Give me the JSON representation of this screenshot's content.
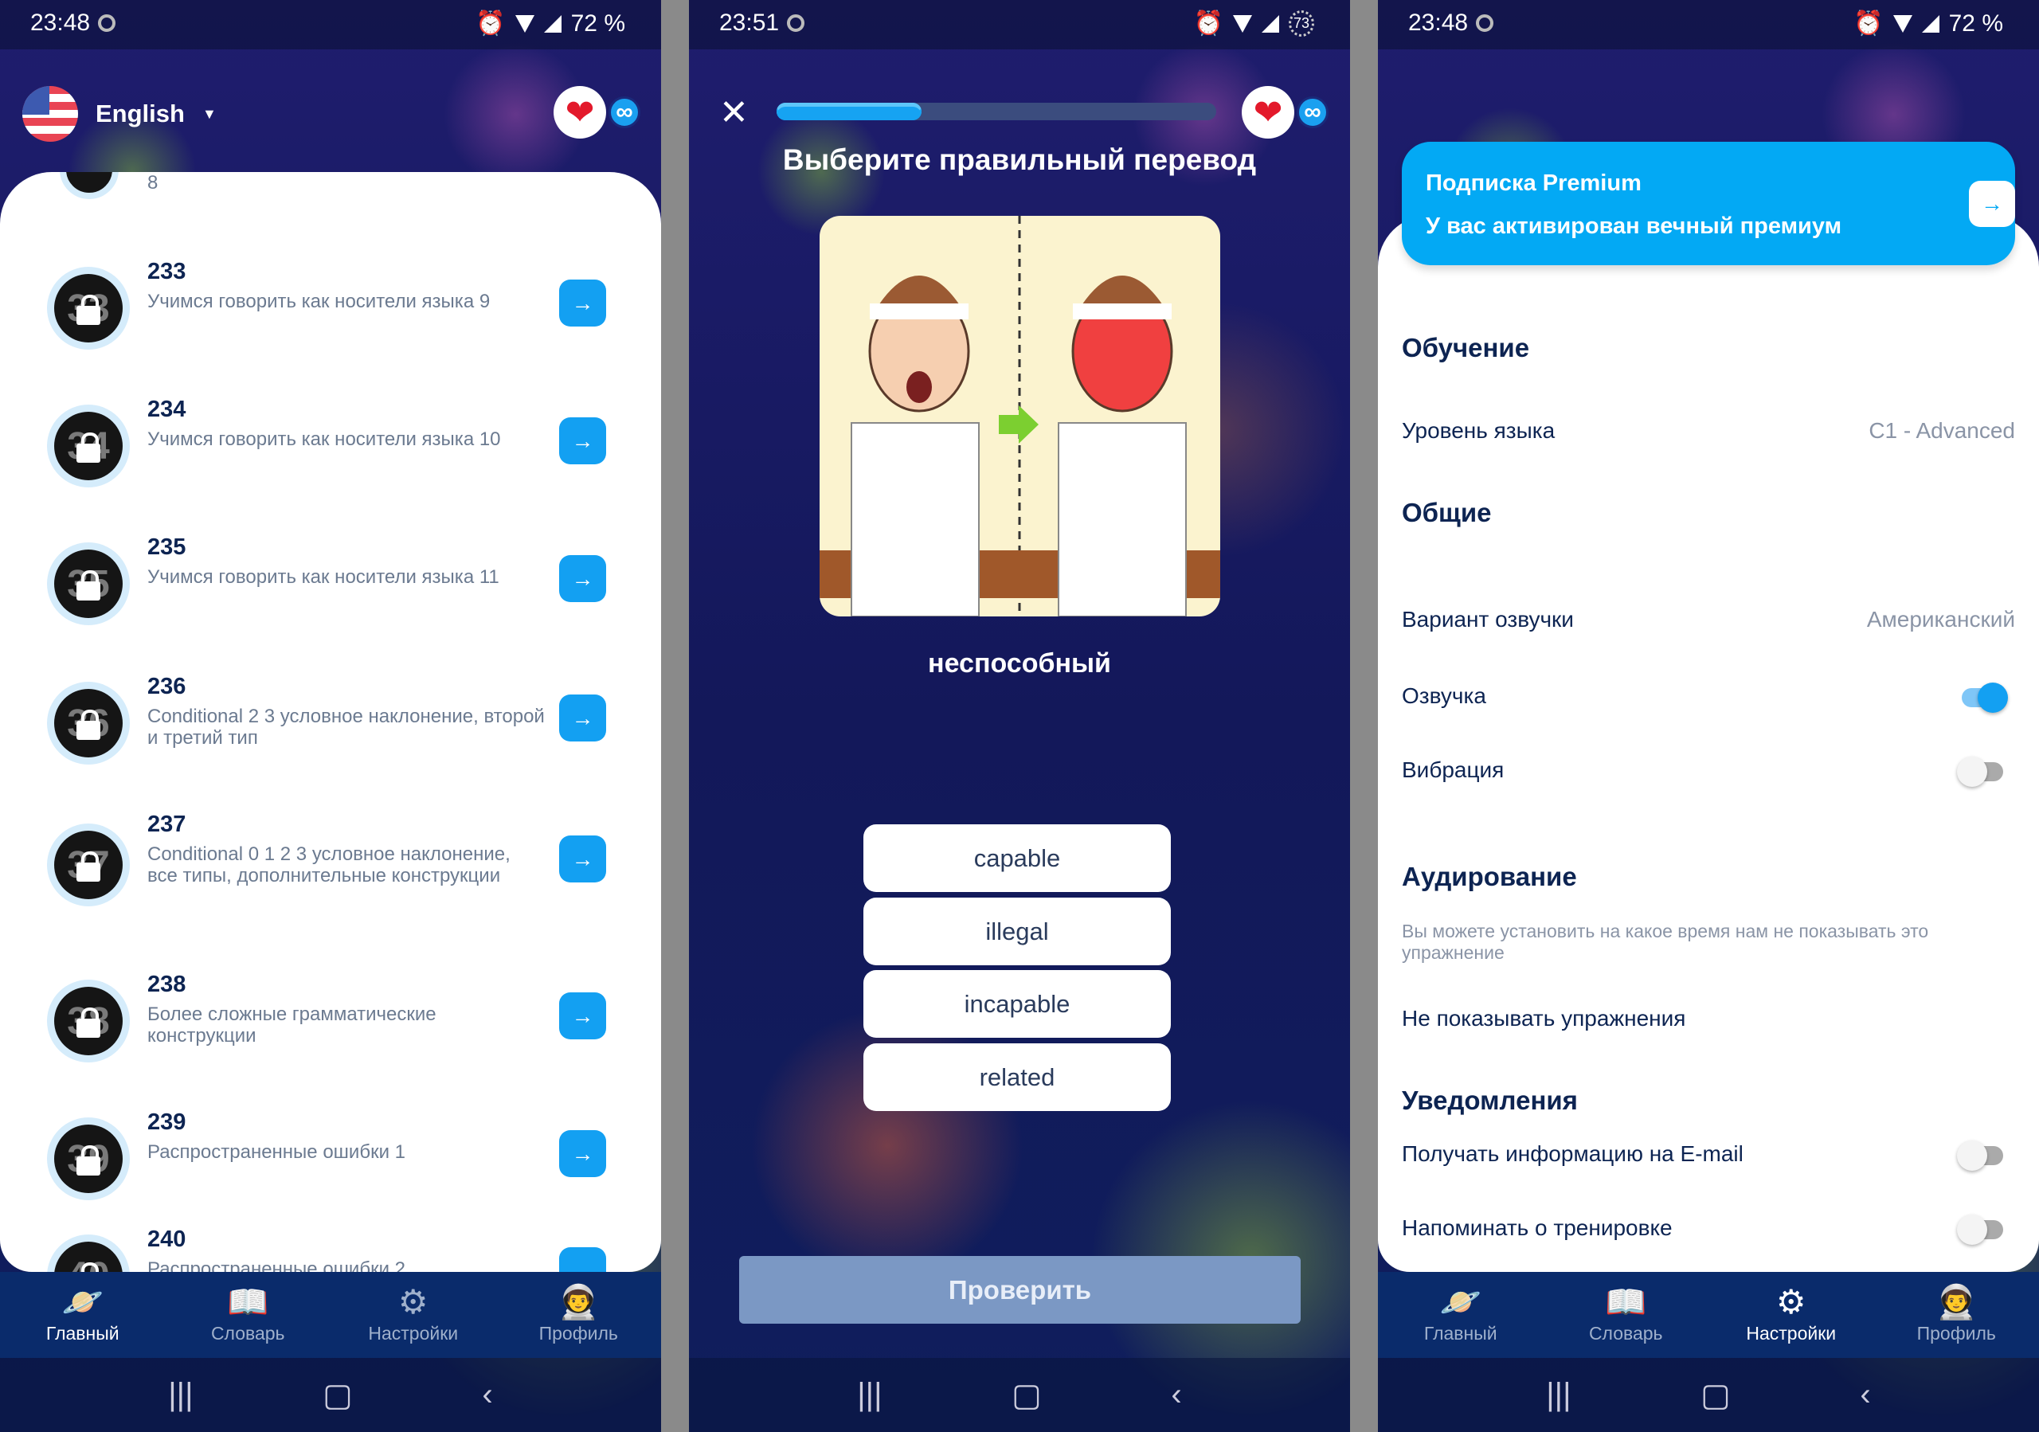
{
  "colors": {
    "accent": "#13a0f2",
    "nav_bg": "#0a2b6b",
    "heading": "#0d2452",
    "premium": "#03a9f4",
    "check_disabled": "#7b98c4"
  },
  "screens": [
    {
      "status": {
        "time": "23:48",
        "battery": "72 %"
      }
    },
    {
      "status": {
        "time": "23:51",
        "battery": "73"
      }
    },
    {
      "status": {
        "time": "23:48",
        "battery": "72 %"
      }
    }
  ],
  "home": {
    "language": "English",
    "lives_icon": "heart-icon",
    "lives": "∞",
    "partial_item_sub": "8",
    "lessons": [
      {
        "num": "233",
        "badge": "33",
        "title": "Учимся говорить как носители языка 9"
      },
      {
        "num": "234",
        "badge": "34",
        "title": "Учимся говорить как носители языка 10"
      },
      {
        "num": "235",
        "badge": "35",
        "title": "Учимся говорить как носители языка 11"
      },
      {
        "num": "236",
        "badge": "36",
        "title": "Conditional  2 3 условное наклонение, второй и третий тип"
      },
      {
        "num": "237",
        "badge": "37",
        "title": "Conditional  0 1 2 3 условное наклонение, все типы, дополнительные конструкции"
      },
      {
        "num": "238",
        "badge": "38",
        "title": "Более сложные грамматические конструкции"
      },
      {
        "num": "239",
        "badge": "39",
        "title": "Распространенные ошибки 1"
      },
      {
        "num": "240",
        "badge": "40",
        "title": "Распространенные ошибки 2"
      }
    ]
  },
  "nav": {
    "tabs": [
      {
        "label": "Главный",
        "icon": "planet-icon"
      },
      {
        "label": "Словарь",
        "icon": "book-icon"
      },
      {
        "label": "Настройки",
        "icon": "gear-icon"
      },
      {
        "label": "Профиль",
        "icon": "astronaut-icon"
      }
    ]
  },
  "quiz": {
    "progress_percent": 33,
    "lives": "∞",
    "instruction": "Выберите правильный перевод",
    "word": "неспособный",
    "options": [
      "capable",
      "illegal",
      "incapable",
      "related"
    ],
    "check_label": "Проверить"
  },
  "settings": {
    "premium_title": "Подписка Premium",
    "premium_subtitle": "У вас активирован вечный премиум",
    "learning": "Обучение",
    "level_label": "Уровень языка",
    "level_value": "C1 - Advanced",
    "general": "Общие",
    "voice_label": "Вариант озвучки",
    "voice_value": "Американский",
    "sound_label": "Озвучка",
    "sound_on": true,
    "vibration_label": "Вибрация",
    "vibration_on": false,
    "listening": "Аудирование",
    "listening_desc": "Вы можете установить на какое время нам не показывать это упражнение",
    "hide_label": "Не показывать упражнения",
    "notifications": "Уведомления",
    "email_label": "Получать информацию на E-mail",
    "email_on": false,
    "remind_label": "Напоминать о тренировке",
    "remind_on": false
  }
}
